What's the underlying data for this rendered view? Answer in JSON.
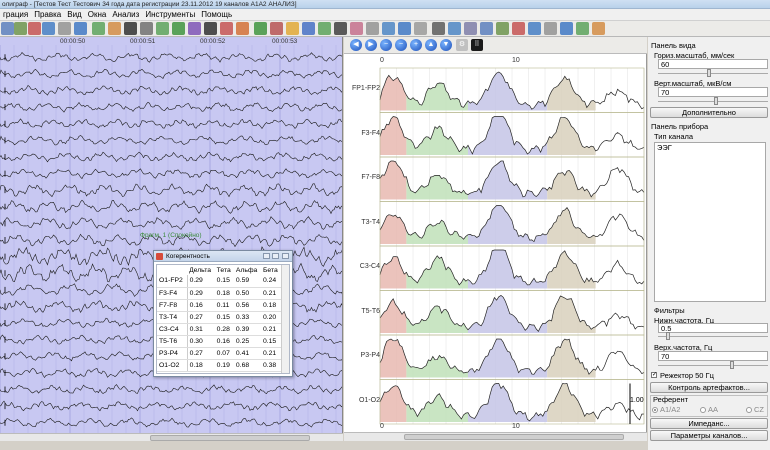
{
  "window": {
    "title": "олиграф - [Тестов Тест Тестович 34 года дата регистрации 23.11.2012 19 каналов A1A2 АНАЛИЗ]"
  },
  "menu": [
    "грация",
    "Правка",
    "Вид",
    "Окна",
    "Анализ",
    "Инструменты",
    "Помощь"
  ],
  "eeg": {
    "time_marks": [
      "00:00:50",
      "00:00:51",
      "00:00:52",
      "00:00:53"
    ],
    "marker_label": "Фрагм. 1 (Спокойно)"
  },
  "coherence": {
    "title": "Когерентность",
    "columns": [
      "",
      "Дельта",
      "Тета",
      "Альфа",
      "Бета"
    ],
    "rows": [
      [
        "O1-FP2",
        "0.29",
        "0.15",
        "0.59",
        "0.24"
      ],
      [
        "F3-F4",
        "0.29",
        "0.18",
        "0.50",
        "0.21"
      ],
      [
        "F7-F8",
        "0.16",
        "0.11",
        "0.56",
        "0.18"
      ],
      [
        "T3-T4",
        "0.27",
        "0.15",
        "0.33",
        "0.20"
      ],
      [
        "C3-C4",
        "0.31",
        "0.28",
        "0.39",
        "0.21"
      ],
      [
        "T5-T6",
        "0.30",
        "0.16",
        "0.25",
        "0.15"
      ],
      [
        "P3-P4",
        "0.27",
        "0.07",
        "0.41",
        "0.21"
      ],
      [
        "O1-O2",
        "0.18",
        "0.19",
        "0.68",
        "0.38"
      ]
    ]
  },
  "spectra": {
    "channels": [
      "FP1-FP2",
      "F3-F4",
      "F7-F8",
      "T3-T4",
      "C3-C4",
      "T5-T6",
      "P3-P4",
      "O1-O2"
    ],
    "axis_top": [
      "0",
      "10"
    ],
    "axis_bottom": [
      "0",
      "10"
    ],
    "cursor_value": "1.00",
    "band_colors": [
      "#e8b8b0",
      "#bfe0b8",
      "#c4c4e6",
      "#d8d0bc"
    ]
  },
  "right_panel": {
    "view_panel_title": "Панель вида",
    "hscale_label": "Гориз.масштаб, мм/сек",
    "hscale_value": "60",
    "vscale_label": "Верт.масштаб, мкВ/см",
    "vscale_value": "70",
    "more_button": "Дополнительно",
    "device_panel_title": "Панель прибора",
    "channel_type_label": "Тип канала",
    "channel_types": [
      "ЭЭГ"
    ],
    "filters_label": "Фильтры",
    "low_freq_label": "Нижн.частота, Гц",
    "low_freq_value": "0.5",
    "high_freq_label": "Верх.частота, Гц",
    "high_freq_value": "70",
    "notch_label": "Режектор 50 Гц",
    "artifacts_button": "Контроль артефактов...",
    "referent_label": "Референт",
    "ref_options": [
      "A1/A2",
      "AA",
      "CZ"
    ],
    "impedance_button": "Импеданс...",
    "channel_params_button": "Параметры каналов..."
  }
}
